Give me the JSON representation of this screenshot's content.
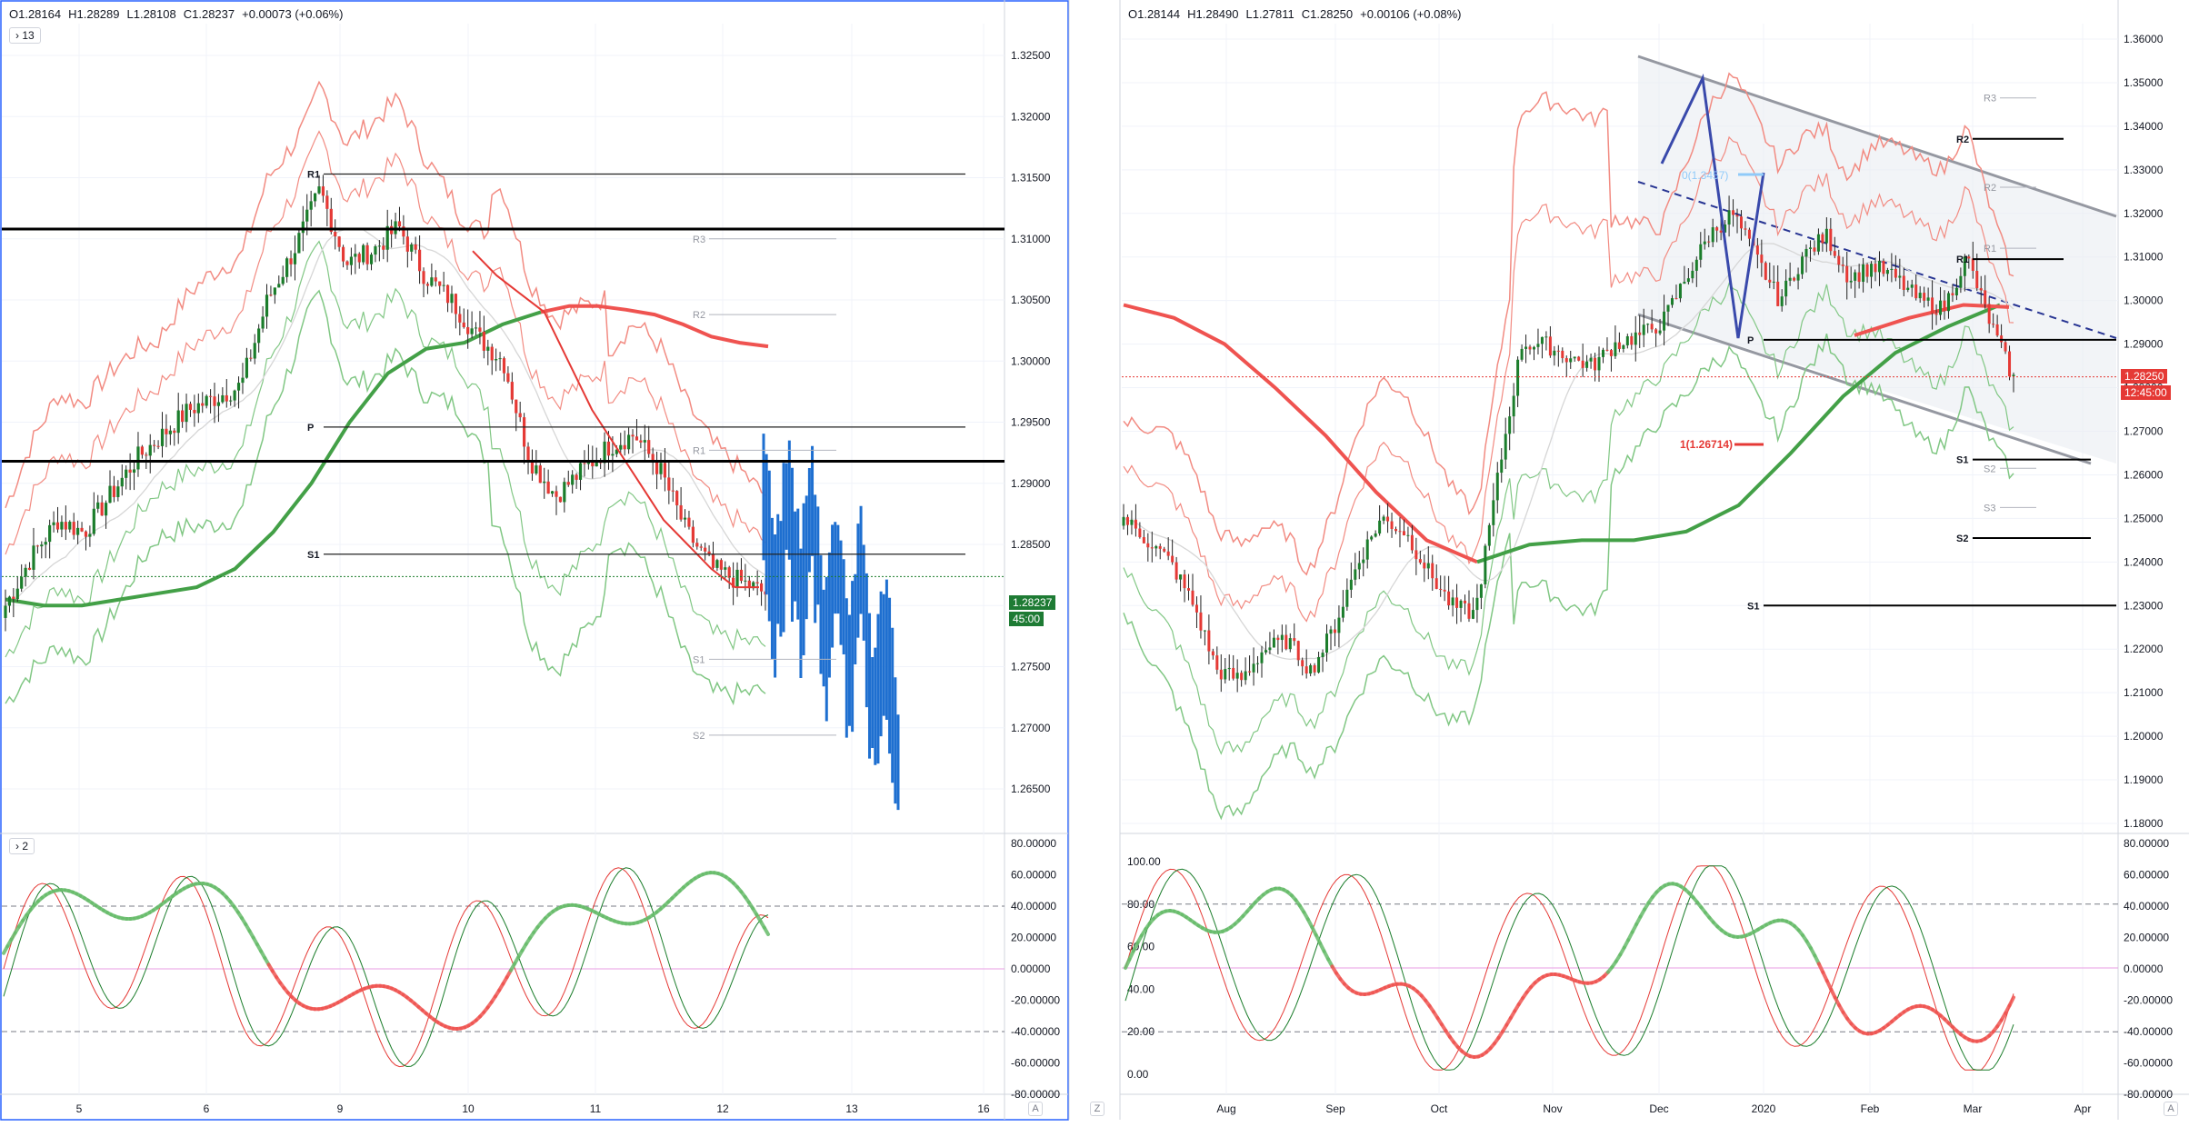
{
  "left_panel": {
    "ohlc": {
      "o": "O1.28164",
      "h": "H1.28289",
      "l": "L1.28108",
      "c": "C1.28237",
      "chg": "+0.00073 (+0.06%)"
    },
    "indicator_toggle": "13",
    "osc_toggle": "2",
    "last_price": "1.28237",
    "countdown": "45:00",
    "axis_button": "A"
  },
  "right_panel": {
    "ohlc": {
      "o": "O1.28144",
      "h": "H1.28490",
      "l": "L1.27811",
      "c": "C1.28250",
      "chg": "+0.00106 (+0.08%)"
    },
    "last_price": "1.28250",
    "countdown": "12:45:00",
    "fib_label_top": "0(1.3457)",
    "fib_label_bottom": "1(1.26714)",
    "zoom_button": "Z",
    "axis_button": "A"
  },
  "chart_data": [
    {
      "type": "candlestick",
      "ylim": [
        1.265,
        1.325
      ],
      "y_ticks": [
        "1.32500",
        "1.32000",
        "1.31500",
        "1.31000",
        "1.30500",
        "1.30000",
        "1.29500",
        "1.29000",
        "1.28500",
        "1.28000",
        "1.27500",
        "1.27000",
        "1.26500"
      ],
      "x_ticks": [
        "5",
        "6",
        "9",
        "10",
        "11",
        "12",
        "13",
        "16"
      ],
      "close_path": [
        1.28,
        1.284,
        1.287,
        1.286,
        1.289,
        1.292,
        1.294,
        1.296,
        1.297,
        1.298,
        1.305,
        1.309,
        1.314,
        1.308,
        1.309,
        1.311,
        1.307,
        1.305,
        1.302,
        1.3,
        1.292,
        1.289,
        1.291,
        1.293,
        1.294,
        1.291,
        1.286,
        1.283,
        1.282,
        1.281
      ],
      "projection_path": [
        1.291,
        1.281,
        1.29,
        1.282,
        1.289,
        1.278,
        1.285,
        1.276,
        1.284,
        1.272,
        1.28,
        1.269
      ],
      "pivot_levels": [
        {
          "label": "R1",
          "value": 1.3153
        },
        {
          "label": "P",
          "value": 1.2946
        },
        {
          "label": "S1",
          "value": 1.2842
        }
      ],
      "minor_pivot_levels": [
        {
          "label": "R3",
          "value": 1.31
        },
        {
          "label": "R2",
          "value": 1.3038
        },
        {
          "label": "R1",
          "value": 1.2927
        },
        {
          "label": "S1",
          "value": 1.2756
        },
        {
          "label": "S2",
          "value": 1.2694
        }
      ],
      "horizontal_lines": [
        1.3108,
        1.2918
      ],
      "last_price": 1.28237
    },
    {
      "type": "oscillator",
      "ylim": [
        -80,
        80
      ],
      "y_ticks": [
        "80.00000",
        "60.00000",
        "40.00000",
        "20.00000",
        "0.00000",
        "-20.00000",
        "-40.00000",
        "-60.00000",
        "-80.00000"
      ],
      "levels": [
        40,
        0,
        -40
      ]
    },
    {
      "type": "candlestick",
      "ylim": [
        1.18,
        1.36
      ],
      "y_ticks": [
        "1.36000",
        "1.35000",
        "1.34000",
        "1.33000",
        "1.32000",
        "1.31000",
        "1.30000",
        "1.29000",
        "1.28000",
        "1.27000",
        "1.26000",
        "1.25000",
        "1.24000",
        "1.23000",
        "1.22000",
        "1.21000",
        "1.20000",
        "1.19000",
        "1.18000"
      ],
      "x_ticks": [
        "Aug",
        "Sep",
        "Oct",
        "Nov",
        "Dec",
        "2020",
        "Feb",
        "Mar",
        "Apr"
      ],
      "close_path": [
        1.25,
        1.245,
        1.24,
        1.23,
        1.215,
        1.213,
        1.22,
        1.222,
        1.215,
        1.225,
        1.24,
        1.25,
        1.247,
        1.238,
        1.23,
        1.228,
        1.26,
        1.29,
        1.29,
        1.287,
        1.285,
        1.29,
        1.292,
        1.295,
        1.305,
        1.315,
        1.32,
        1.31,
        1.3,
        1.31,
        1.315,
        1.305,
        1.308,
        1.305,
        1.3,
        1.298,
        1.31,
        1.295,
        1.282
      ],
      "pivot_levels": [
        {
          "label": "R2",
          "value": 1.3371
        },
        {
          "label": "R1",
          "value": 1.3095
        },
        {
          "label": "P",
          "value": 1.291
        },
        {
          "label": "S1",
          "value": 1.2635
        },
        {
          "label": "S2",
          "value": 1.2455
        },
        {
          "label": "S1",
          "value": 1.23
        }
      ],
      "minor_pivot_levels": [
        {
          "label": "R3",
          "value": 1.3465
        },
        {
          "label": "R2",
          "value": 1.326
        },
        {
          "label": "R1",
          "value": 1.312
        },
        {
          "label": "S2",
          "value": 1.2615
        },
        {
          "label": "S3",
          "value": 1.2525
        }
      ],
      "fib_levels": [
        1.3457,
        1.26714
      ],
      "last_price": 1.2825
    },
    {
      "type": "oscillator",
      "ylim": [
        0,
        100
      ],
      "y_ticks": [
        "100.00",
        "80.00",
        "60.00",
        "40.00",
        "20.00",
        "0.00"
      ],
      "right_ticks": [
        "80.00000",
        "60.00000",
        "40.00000",
        "20.00000",
        "0.00000",
        "-20.00000",
        "-40.00000",
        "-60.00000",
        "-80.00000"
      ],
      "levels": [
        80,
        50,
        20
      ]
    }
  ],
  "colors": {
    "up": "#1b7d2b",
    "down": "#e53935",
    "band_red": "#f28b82",
    "band_green": "#81c784",
    "ma_red": "#ef5350",
    "ma_green": "#43a047",
    "projection": "#1e6fd0",
    "channel": "#9598a1",
    "last_left": "#1e7b34",
    "last_right": "#e53935"
  }
}
